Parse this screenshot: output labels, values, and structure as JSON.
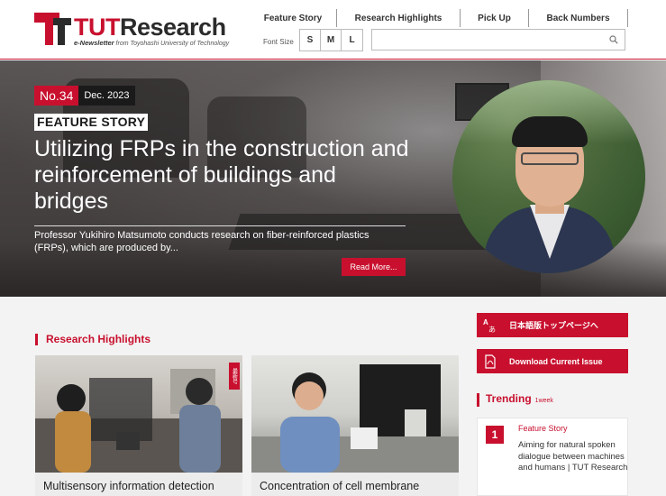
{
  "logo": {
    "tut": "TUT",
    "research": "Research",
    "sub_prefix": "e-Newsletter",
    "sub_suffix": " from Toyohashi University of Technology"
  },
  "nav": {
    "items": [
      {
        "label": "Feature Story"
      },
      {
        "label": "Research Highlights"
      },
      {
        "label": "Pick Up"
      },
      {
        "label": "Back Numbers"
      }
    ]
  },
  "font_size": {
    "label": "Font Size",
    "options": [
      "S",
      "M",
      "L"
    ]
  },
  "search": {
    "value": "",
    "icon": "search-icon"
  },
  "hero": {
    "issue_no": "No.34",
    "issue_date": "Dec. 2023",
    "label": "FEATURE STORY",
    "title": "Utilizing FRPs in the construction and reinforcement of buildings and bridges",
    "description": "Professor Yukihiro Matsumoto conducts research on fiber-reinforced plastics (FRPs), which are produced by...",
    "read_more": "Read More..."
  },
  "research_highlights": {
    "title": "Research Highlights",
    "cards": [
      {
        "caption": "Multisensory information detection",
        "tag": "最新号"
      },
      {
        "caption": "Concentration of cell membrane"
      }
    ]
  },
  "sidebar": {
    "japanese_top": "日本語版トップページへ",
    "japanese_icon_glyph": "Aあ",
    "download": "Download Current Issue",
    "trending": {
      "title": "Trending",
      "period": "1week",
      "items": [
        {
          "rank": "1",
          "category": "Feature Story",
          "text": "Aiming for natural spoken dialogue between machines and humans | TUT Research"
        }
      ]
    }
  },
  "colors": {
    "accent": "#c8102e",
    "dark": "#2b2b2b"
  }
}
